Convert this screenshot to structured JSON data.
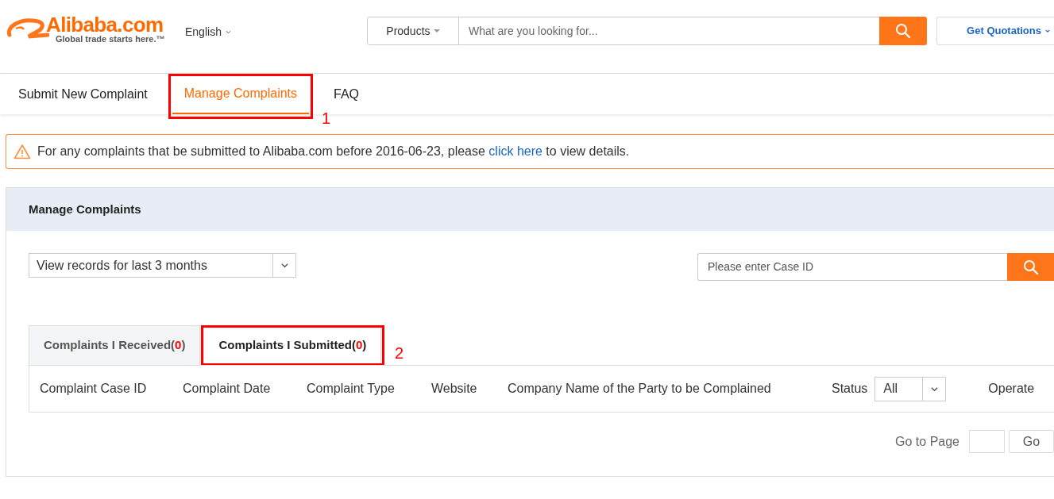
{
  "header": {
    "logo": {
      "name": "Alibaba.com",
      "tagline": "Global trade starts here.™"
    },
    "language": "English",
    "search": {
      "category": "Products",
      "placeholder": "What are you looking for..."
    },
    "quotations": "Get Quotations"
  },
  "nav_tabs": [
    {
      "label": "Submit New Complaint",
      "selected": false
    },
    {
      "label": "Manage Complaints",
      "selected": true,
      "annotation": "1"
    },
    {
      "label": "FAQ",
      "selected": false
    }
  ],
  "notice": {
    "before": "For any complaints that be submitted to Alibaba.com before 2016-06-23, please",
    "link": "click here",
    "after": "to view details."
  },
  "panel": {
    "title": "Manage Complaints",
    "period": "View records for last 3 months",
    "case_search": {
      "placeholder": "Please enter Case ID"
    },
    "tabs": [
      {
        "label": "Complaints I Received",
        "open": "(",
        "count": "0",
        "close": ")",
        "selected": false
      },
      {
        "label": "Complaints I Submitted",
        "open": "(",
        "count": "0",
        "close": ")",
        "selected": true,
        "annotation": "2"
      }
    ],
    "columns": [
      "Complaint Case ID",
      "Complaint Date",
      "Complaint Type",
      "Website",
      "Company Name of the Party to be Complained"
    ],
    "status": {
      "label": "Status",
      "value": "All"
    },
    "operate": "Operate",
    "pagination": {
      "label": "Go to Page",
      "button": "Go"
    }
  }
}
